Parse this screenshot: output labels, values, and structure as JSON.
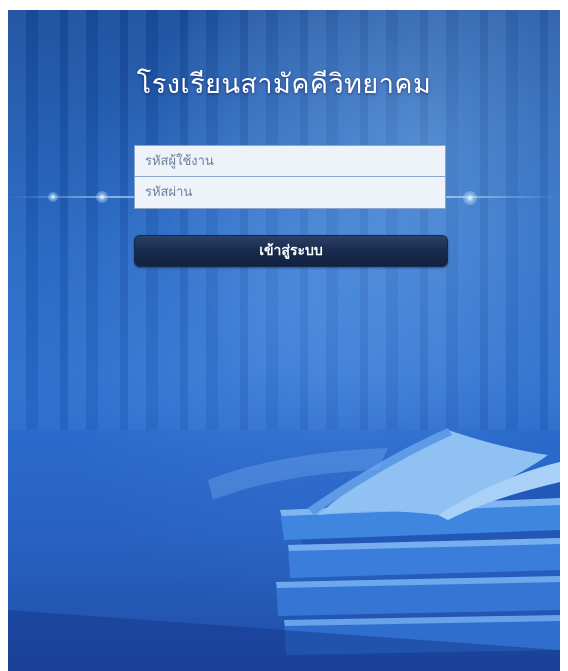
{
  "login": {
    "school_name": "โรงเรียนสามัคคีวิทยาคม",
    "username_placeholder": "รหัสผู้ใช้งาน",
    "username_value": "",
    "password_placeholder": "รหัสผ่าน",
    "password_value": "",
    "submit_label": "เข้าสู่ระบบ"
  },
  "colors": {
    "background": "#2466c2",
    "button": "#182b4d",
    "field": "#eef3fa"
  },
  "decor": {
    "background_image": "books-illustration"
  }
}
